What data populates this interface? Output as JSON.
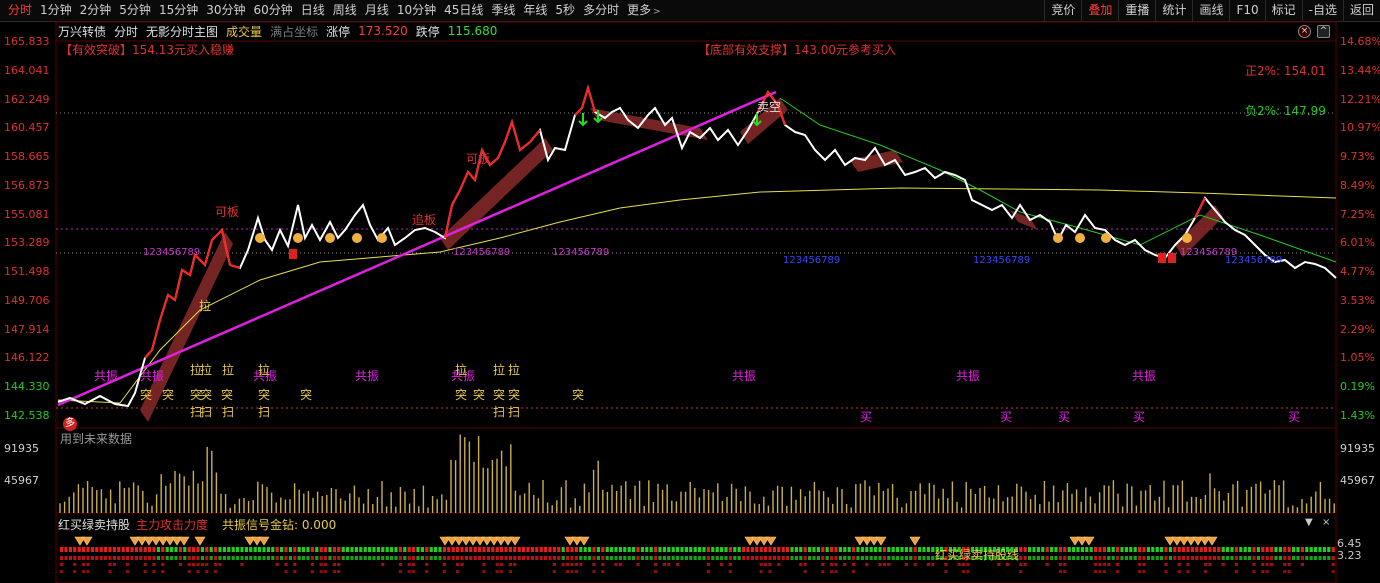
{
  "toolbar": {
    "tabs": [
      "分时",
      "1分钟",
      "2分钟",
      "5分钟",
      "15分钟",
      "30分钟",
      "60分钟",
      "日线",
      "周线",
      "月线",
      "10分钟",
      "45日线",
      "季线",
      "年线",
      "5秒",
      "多分时",
      "更多"
    ],
    "active_tab": "分时",
    "right_buttons": [
      "竞价",
      "叠加",
      "重播",
      "统计",
      "画线",
      "F10",
      "标记",
      "-自选",
      "返回"
    ]
  },
  "title": {
    "name": "万兴转债",
    "mode": "分时",
    "subtitle": "无影分时主图",
    "volume": "成交量",
    "full_coord": "满占坐标",
    "limit_up_label": "涨停",
    "limit_up_value": "173.520",
    "limit_down_label": "跌停",
    "limit_down_value": "115.680"
  },
  "left_axis": [
    "165.833",
    "164.041",
    "162.249",
    "160.457",
    "158.665",
    "156.873",
    "155.081",
    "153.289",
    "151.498",
    "149.706",
    "147.914",
    "146.122",
    "144.330",
    "142.538"
  ],
  "right_axis": [
    {
      "v": "14.68%",
      "c": "up"
    },
    {
      "v": "13.44%",
      "c": "up"
    },
    {
      "v": "12.21%",
      "c": "up"
    },
    {
      "v": "10.97%",
      "c": "up"
    },
    {
      "v": "9.73%",
      "c": "up"
    },
    {
      "v": "8.49%",
      "c": "up"
    },
    {
      "v": "7.25%",
      "c": "up"
    },
    {
      "v": "6.01%",
      "c": "up"
    },
    {
      "v": "4.77%",
      "c": "up"
    },
    {
      "v": "3.53%",
      "c": "up"
    },
    {
      "v": "2.29%",
      "c": "up"
    },
    {
      "v": "1.05%",
      "c": "up"
    },
    {
      "v": "0.19%",
      "c": "dn"
    },
    {
      "v": "1.43%",
      "c": "dn"
    }
  ],
  "annotations": {
    "breakout": "【有效突破】154.13元买入稳赚",
    "support": "【底部有效支撑】143.00元参考买入",
    "plus2": "正2%: 154.01",
    "minus2": "负2%: 147.99",
    "future": "用到未来数据"
  },
  "labels": {
    "keban1": "可板",
    "keban2": "可板",
    "zhuiban": "追板",
    "la": "拉",
    "tu": "突",
    "sao": "扫",
    "gongzhen": "共振",
    "mai": "买",
    "duo": "多",
    "maikong": "卖空",
    "seq": "123456789"
  },
  "volume_axis": {
    "left": [
      "91935",
      "45967"
    ],
    "right": [
      "91935",
      "45967"
    ]
  },
  "bottom": {
    "title": "红买绿卖持股",
    "force": "主力攻击力度",
    "signal": "共振信号金钻: 0.000",
    "center": "红买绿卖持股线",
    "right_top": "6.45",
    "right_bot": "3.23"
  },
  "colors": {
    "up": "#e03030",
    "down": "#22cc22",
    "magenta": "#e020e0",
    "yellow": "#e6c84a",
    "gold": "#f0a040"
  }
}
